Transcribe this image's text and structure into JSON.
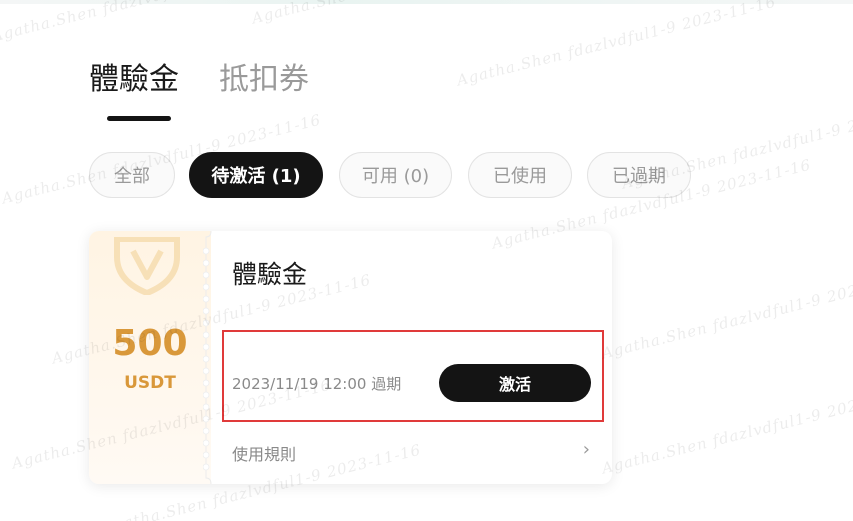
{
  "tabs": {
    "experience": "體驗金",
    "deduction": "抵扣券"
  },
  "filters": {
    "all": "全部",
    "pending": "待激活 (1)",
    "available": "可用 (0)",
    "used": "已使用",
    "expired": "已過期"
  },
  "card": {
    "amount": "500",
    "currency": "USDT",
    "title": "體驗金",
    "expiry": "2023/11/19 12:00 過期",
    "activate_label": "激活",
    "rules_label": "使用規則",
    "rules_chevron": "›"
  },
  "watermark": {
    "line": "Agatha.Shen fdazlvdful1-9 2023-11-16"
  },
  "colors": {
    "accent_dark": "#141414",
    "amount_gold": "#d9983a",
    "highlight_red": "#e03a3a"
  }
}
